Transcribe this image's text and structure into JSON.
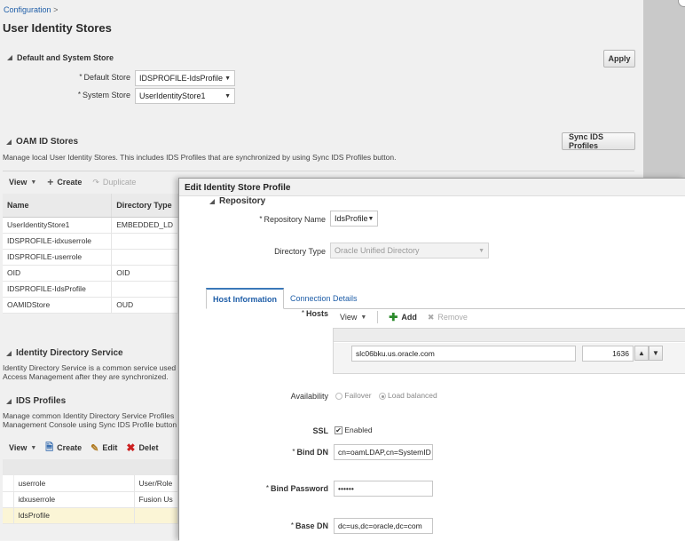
{
  "breadcrumb": {
    "link": "Configuration",
    "separator": ">"
  },
  "page_title": "User Identity Stores",
  "default_system": {
    "section_title": "Default and System Store",
    "apply_label": "Apply",
    "default_store_label": "Default Store",
    "default_store_value": "IDSPROFILE-IdsProfile",
    "system_store_label": "System Store",
    "system_store_value": "UserIdentityStore1"
  },
  "oam_stores": {
    "section_title": "OAM ID Stores",
    "sync_button": "Sync IDS Profiles",
    "description": "Manage local User Identity Stores. This includes IDS Profiles that are synchronized by using Sync IDS Profiles button.",
    "toolbar": {
      "view": "View",
      "create": "Create",
      "duplicate": "Duplicate"
    },
    "columns": [
      "Name",
      "Directory Type"
    ],
    "rows": [
      [
        "UserIdentityStore1",
        "EMBEDDED_LD"
      ],
      [
        "IDSPROFILE-idxuserrole",
        ""
      ],
      [
        "IDSPROFILE-userrole",
        ""
      ],
      [
        "OID",
        "OID"
      ],
      [
        "IDSPROFILE-IdsProfile",
        ""
      ],
      [
        "OAMIDStore",
        "OUD"
      ]
    ]
  },
  "identity_directory": {
    "section_title": "Identity Directory Service",
    "description_line1": "Identity Directory Service is a common service used",
    "description_line2": "Access Management after they are synchronized."
  },
  "ids_profiles": {
    "section_title": "IDS Profiles",
    "description_line1": "Manage common Identity Directory Service Profiles",
    "description_line2": "Management Console using Sync IDS Profile button",
    "toolbar": {
      "view": "View",
      "create": "Create",
      "edit": "Edit",
      "delete": "Delet"
    },
    "rows": [
      [
        "userrole",
        "User/Role"
      ],
      [
        "idxuserrole",
        "Fusion Us"
      ],
      [
        "IdsProfile",
        ""
      ]
    ]
  },
  "dialog": {
    "title": "Edit Identity Store Profile",
    "repository_section": "Repository",
    "repository_name_label": "Repository Name",
    "repository_name_value": "IdsProfile",
    "directory_type_label": "Directory Type",
    "directory_type_value": "Oracle Unified Directory",
    "tabs": [
      "Host Information",
      "Connection Details"
    ],
    "hosts_label": "Hosts",
    "hosts_toolbar": {
      "view": "View",
      "add": "Add",
      "remove": "Remove"
    },
    "host_value": "slc06bku.us.oracle.com",
    "port_value": "1636",
    "availability_label": "Availability",
    "availability_options": [
      "Failover",
      "Load balanced"
    ],
    "ssl_label": "SSL",
    "ssl_enabled_label": "Enabled",
    "bind_dn_label": "Bind DN",
    "bind_dn_value": "cn=oamLDAP,cn=SystemID",
    "bind_password_label": "Bind Password",
    "bind_password_value": "••••••",
    "base_dn_label": "Base DN",
    "base_dn_value": "dc=us,dc=oracle,dc=com"
  }
}
